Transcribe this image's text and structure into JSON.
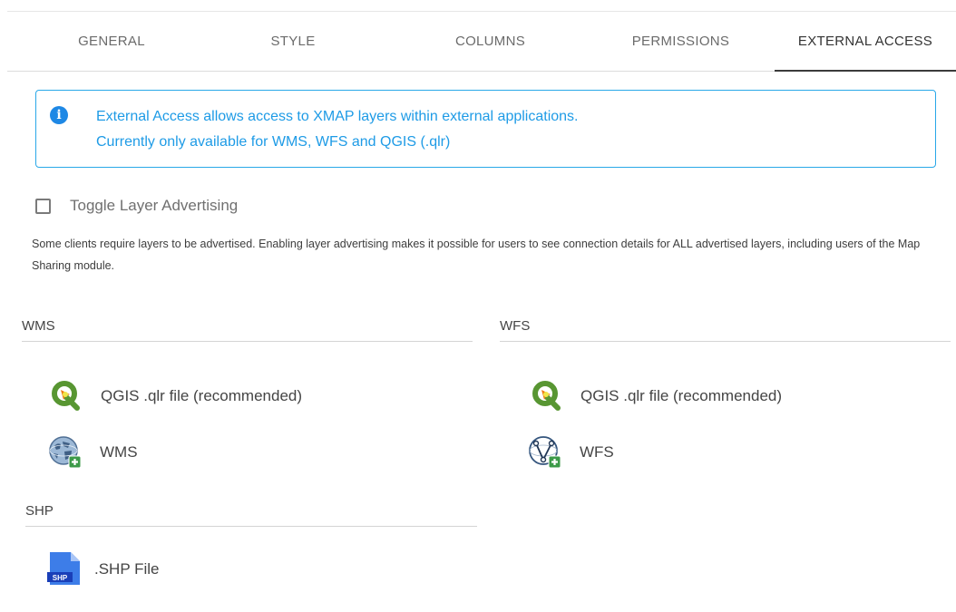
{
  "tabs": [
    {
      "label": "GENERAL"
    },
    {
      "label": "STYLE"
    },
    {
      "label": "COLUMNS"
    },
    {
      "label": "PERMISSIONS"
    },
    {
      "label": "EXTERNAL ACCESS",
      "active": true
    }
  ],
  "info": {
    "icon": "info-icon",
    "line1": "External Access allows access to XMAP layers within external applications.",
    "line2": "Currently only available for WMS, WFS and QGIS (.qlr)",
    "color": "#1e9be6"
  },
  "advertising": {
    "label": "Toggle Layer Advertising",
    "checked": false,
    "help": "Some clients require layers to be advertised. Enabling layer advertising makes it possible for users to see connection details for ALL advertised layers, including users of the Map Sharing module."
  },
  "sections": {
    "wms": {
      "title": "WMS",
      "items": [
        {
          "label": "QGIS .qlr file (recommended)",
          "icon": "qgis-icon"
        },
        {
          "label": "WMS",
          "icon": "wms-globe-icon"
        }
      ]
    },
    "wfs": {
      "title": "WFS",
      "items": [
        {
          "label": "QGIS .qlr file (recommended)",
          "icon": "qgis-icon"
        },
        {
          "label": "WFS",
          "icon": "wfs-vector-icon"
        }
      ]
    },
    "shp": {
      "title": "SHP",
      "items": [
        {
          "label": ".SHP File",
          "icon": "shp-file-icon",
          "badge": "SHP"
        }
      ]
    }
  }
}
